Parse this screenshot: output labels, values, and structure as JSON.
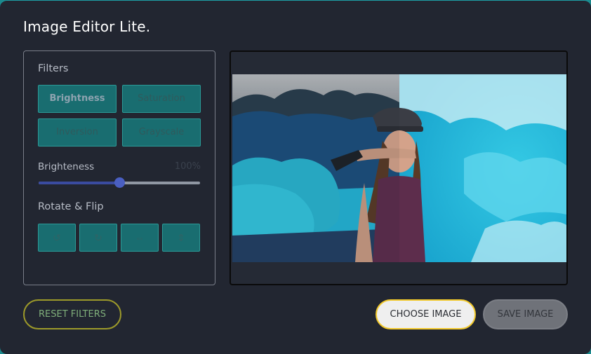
{
  "app": {
    "title": "Image Editor Lite."
  },
  "filters": {
    "heading": "Filters",
    "buttons": [
      {
        "label": "Brightness",
        "active": true
      },
      {
        "label": "Saturation",
        "active": false
      },
      {
        "label": "Inversion",
        "active": false
      },
      {
        "label": "Grayscale",
        "active": false
      }
    ]
  },
  "slider": {
    "label": "Brighteness",
    "value_text": "100%",
    "value": 100,
    "max": 200
  },
  "rotate": {
    "heading": "Rotate & Flip",
    "buttons": [
      {
        "icon": "rotate-left-icon",
        "glyph": "↺"
      },
      {
        "icon": "rotate-right-icon",
        "glyph": "↻"
      },
      {
        "icon": "flip-horizontal-icon",
        "glyph": "⇔"
      },
      {
        "icon": "flip-vertical-icon",
        "glyph": "⇕"
      }
    ]
  },
  "actions": {
    "reset_label": "RESET FILTERS",
    "choose_label": "CHOOSE IMAGE",
    "save_label": "SAVE IMAGE"
  },
  "colors": {
    "accent": "#196d70",
    "reset_border": "#9d9a2a",
    "choose_border": "#f2c92b"
  }
}
